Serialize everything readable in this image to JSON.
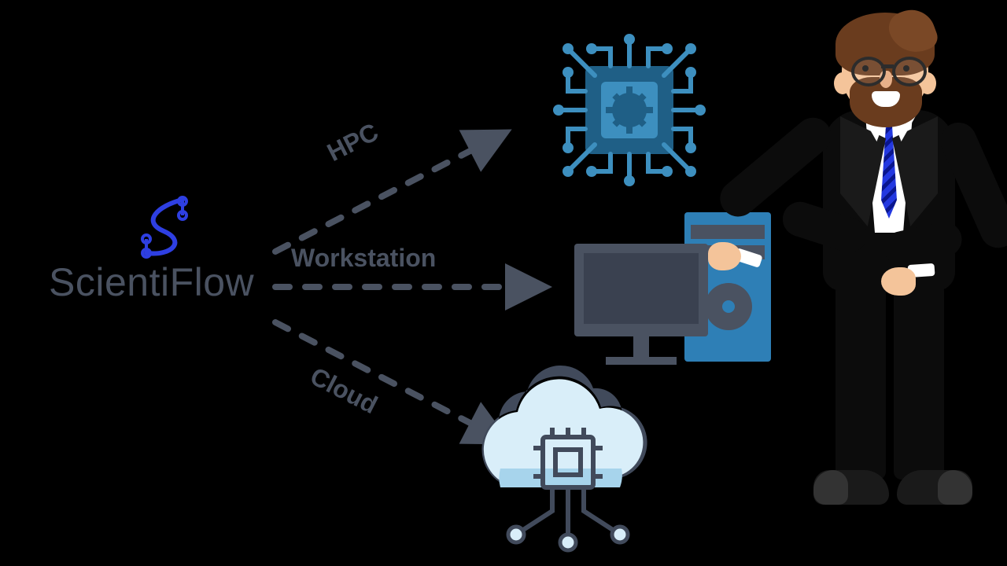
{
  "brand": {
    "name": "ScientiFlow"
  },
  "targets": {
    "hpc": {
      "label": "HPC",
      "icon": "cpu-chip-icon"
    },
    "workstation": {
      "label": "Workstation",
      "icon": "desktop-server-icon"
    },
    "cloud": {
      "label": "Cloud",
      "icon": "cloud-compute-icon"
    }
  },
  "colors": {
    "slate": "#4a5261",
    "blue": "#2e7fb6",
    "sky": "#bfe3f6",
    "indigo": "#2e3fe2",
    "black": "#0c0c0c"
  },
  "presenter": {
    "description": "bearded man in glasses and black suit gesturing toward diagram",
    "icon": "businessman-suit-icon"
  }
}
